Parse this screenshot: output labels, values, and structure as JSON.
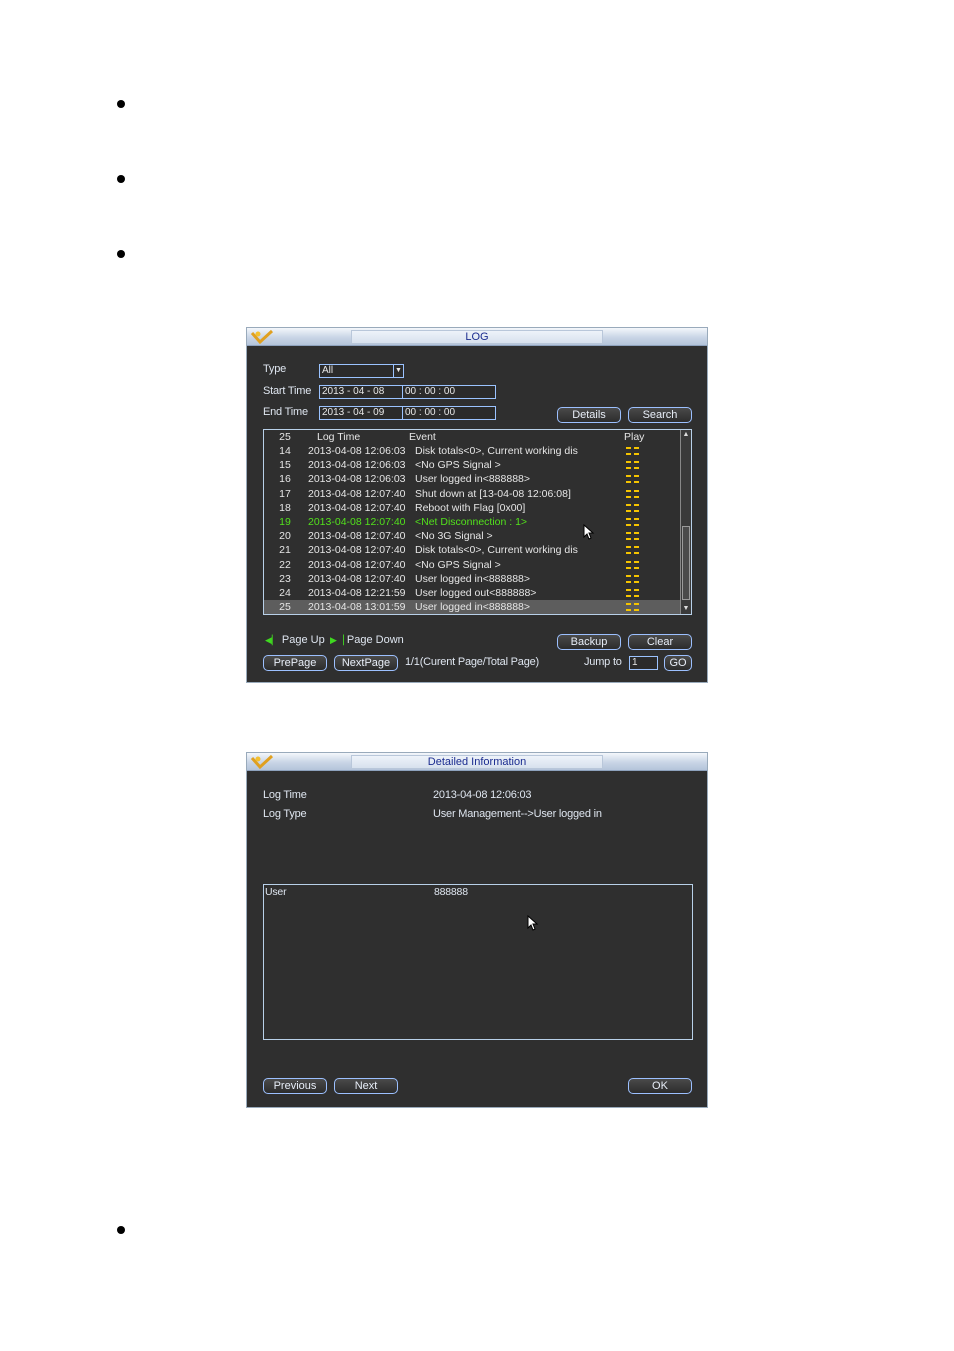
{
  "log_window": {
    "title": "LOG",
    "type_label": "Type",
    "type_value": "All",
    "start_label": "Start Time",
    "start_date": "2013  -  04  -  08",
    "start_time": "00  :  00  :  00",
    "end_label": "End Time",
    "end_date": "2013  -  04  -  09",
    "end_time": "00  :  00  :  00",
    "details_btn": "Details",
    "search_btn": "Search",
    "columns": {
      "count": "25",
      "log_time": "Log Time",
      "event": "Event",
      "play": "Play"
    },
    "rows": [
      {
        "no": "14",
        "time": "2013-04-08 12:06:03",
        "event": "Disk totals<0>, Current working dis"
      },
      {
        "no": "15",
        "time": "2013-04-08 12:06:03",
        "event": "<No GPS Signal >"
      },
      {
        "no": "16",
        "time": "2013-04-08 12:06:03",
        "event": "User logged in<888888>"
      },
      {
        "no": "17",
        "time": "2013-04-08 12:07:40",
        "event": "Shut down at [13-04-08 12:06:08]"
      },
      {
        "no": "18",
        "time": "2013-04-08 12:07:40",
        "event": "Reboot with Flag [0x00]"
      },
      {
        "no": "19",
        "time": "2013-04-08 12:07:40",
        "event": "<Net Disconnection : 1>"
      },
      {
        "no": "20",
        "time": "2013-04-08 12:07:40",
        "event": "<No 3G Signal >"
      },
      {
        "no": "21",
        "time": "2013-04-08 12:07:40",
        "event": "Disk totals<0>, Current working dis"
      },
      {
        "no": "22",
        "time": "2013-04-08 12:07:40",
        "event": "<No GPS Signal >"
      },
      {
        "no": "23",
        "time": "2013-04-08 12:07:40",
        "event": "User logged in<888888>"
      },
      {
        "no": "24",
        "time": "2013-04-08 12:21:59",
        "event": "User logged out<888888>"
      },
      {
        "no": "25",
        "time": "2013-04-08 13:01:59",
        "event": "User logged in<888888>"
      }
    ],
    "highlight_row_color": "#52e01c",
    "page_up": "Page Up",
    "page_down": "Page Down",
    "backup_btn": "Backup",
    "clear_btn": "Clear",
    "prepage_btn": "PrePage",
    "nextpage_btn": "NextPage",
    "page_info": "1/1(Curent Page/Total Page)",
    "jump_label": "Jump to",
    "jump_value": "1",
    "go_btn": "GO"
  },
  "detail_window": {
    "title": "Detailed Information",
    "log_time_label": "Log Time",
    "log_time_value": "2013-04-08 12:06:03",
    "log_type_label": "Log Type",
    "log_type_value": "User Management-->User logged in",
    "user_label": "User",
    "user_value": "888888",
    "previous_btn": "Previous",
    "next_btn": "Next",
    "ok_btn": "OK"
  },
  "colors": {
    "window_bg": "#2f2f2f",
    "button_border": "#9cc0ff",
    "title_text": "#1a2b8f"
  }
}
